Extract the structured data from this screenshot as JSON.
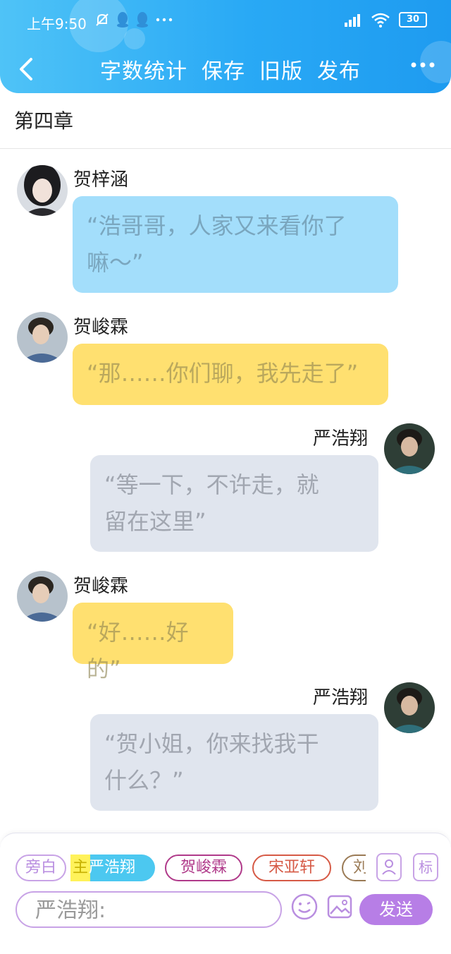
{
  "status_bar": {
    "time": "上午9:50",
    "battery": "30"
  },
  "nav": {
    "actions": [
      "字数统计",
      "保存",
      "旧版",
      "发布"
    ],
    "more": "···"
  },
  "chapter": {
    "title": "第四章"
  },
  "messages": [
    {
      "speaker": "贺梓涵",
      "text": "“浩哥哥，人家又来看你了嘛～”",
      "line1": "“浩哥哥，人家又来看你了",
      "line2": "嘛～”",
      "color": "blue",
      "side": "left"
    },
    {
      "speaker": "贺峻霖",
      "text": "“那……你们聊，我先走了”",
      "color": "yellow",
      "side": "left"
    },
    {
      "speaker": "严浩翔",
      "text": "“等一下，不许走，就留在这里”",
      "line1": "“等一下，不许走，就",
      "line2": "留在这里”",
      "color": "gray",
      "side": "right"
    },
    {
      "speaker": "贺峻霖",
      "text": "“好……好的”",
      "color": "yellow",
      "side": "left"
    },
    {
      "speaker": "严浩翔",
      "text": "“贺小姐，你来找我干什么？”",
      "line1": "“贺小姐，你来找我干",
      "line2": "什么？”",
      "color": "gray",
      "side": "right"
    }
  ],
  "composer": {
    "roles": {
      "aside": "旁白",
      "main_tag": "主",
      "main_name": "严浩翔",
      "role2": "贺峻霖",
      "role3": "宋亚轩",
      "role4_partial": "刘"
    },
    "tag_icon_label": "标",
    "input_placeholder": "严浩翔:",
    "send_label": "发送"
  },
  "colors": {
    "header_gradient_start": "#4fc3f7",
    "header_gradient_end": "#1e9bf0",
    "bubble_blue": "#a3defb",
    "bubble_yellow": "#ffe070",
    "bubble_gray": "#e0e5ee",
    "accent_purple": "#b77ee6"
  }
}
